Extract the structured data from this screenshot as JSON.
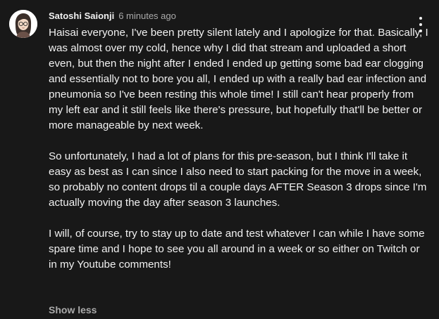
{
  "comment": {
    "author": "Satoshi Saionji",
    "timestamp": "6 minutes ago",
    "paragraphs": [
      "Haisai everyone, I've been pretty silent lately and I apologize for that. Basically, I was almost over my cold, hence why I did that stream and uploaded a short even, but then the night after I ended I ended up getting some bad ear clogging and essentially not to bore you all, I ended up with a really bad ear infection and pneumonia so I've been resting this whole time! I still can't hear properly from my left ear and it still feels like there's pressure, but hopefully that'll be better or more manageable by next week.",
      "So unfortunately, I had a lot of plans for this pre-season, but I think I'll take it easy as best as I can since I also need to start packing for the move in a week, so probably no content drops til a couple days AFTER Season 3 drops since I'm actually moving the day after season 3 launches.",
      "I will, of course, try to stay up to date and test whatever I can while I have some spare time and I hope to see you all around in a week or so either on Twitch or in my Youtube comments!"
    ],
    "show_less_label": "Show less"
  },
  "icons": {
    "avatar": "avatar-image",
    "menu": "more-vert-icon"
  },
  "colors": {
    "background": "#181818",
    "text_primary": "#f1f1f1",
    "text_secondary": "#aaaaaa"
  }
}
